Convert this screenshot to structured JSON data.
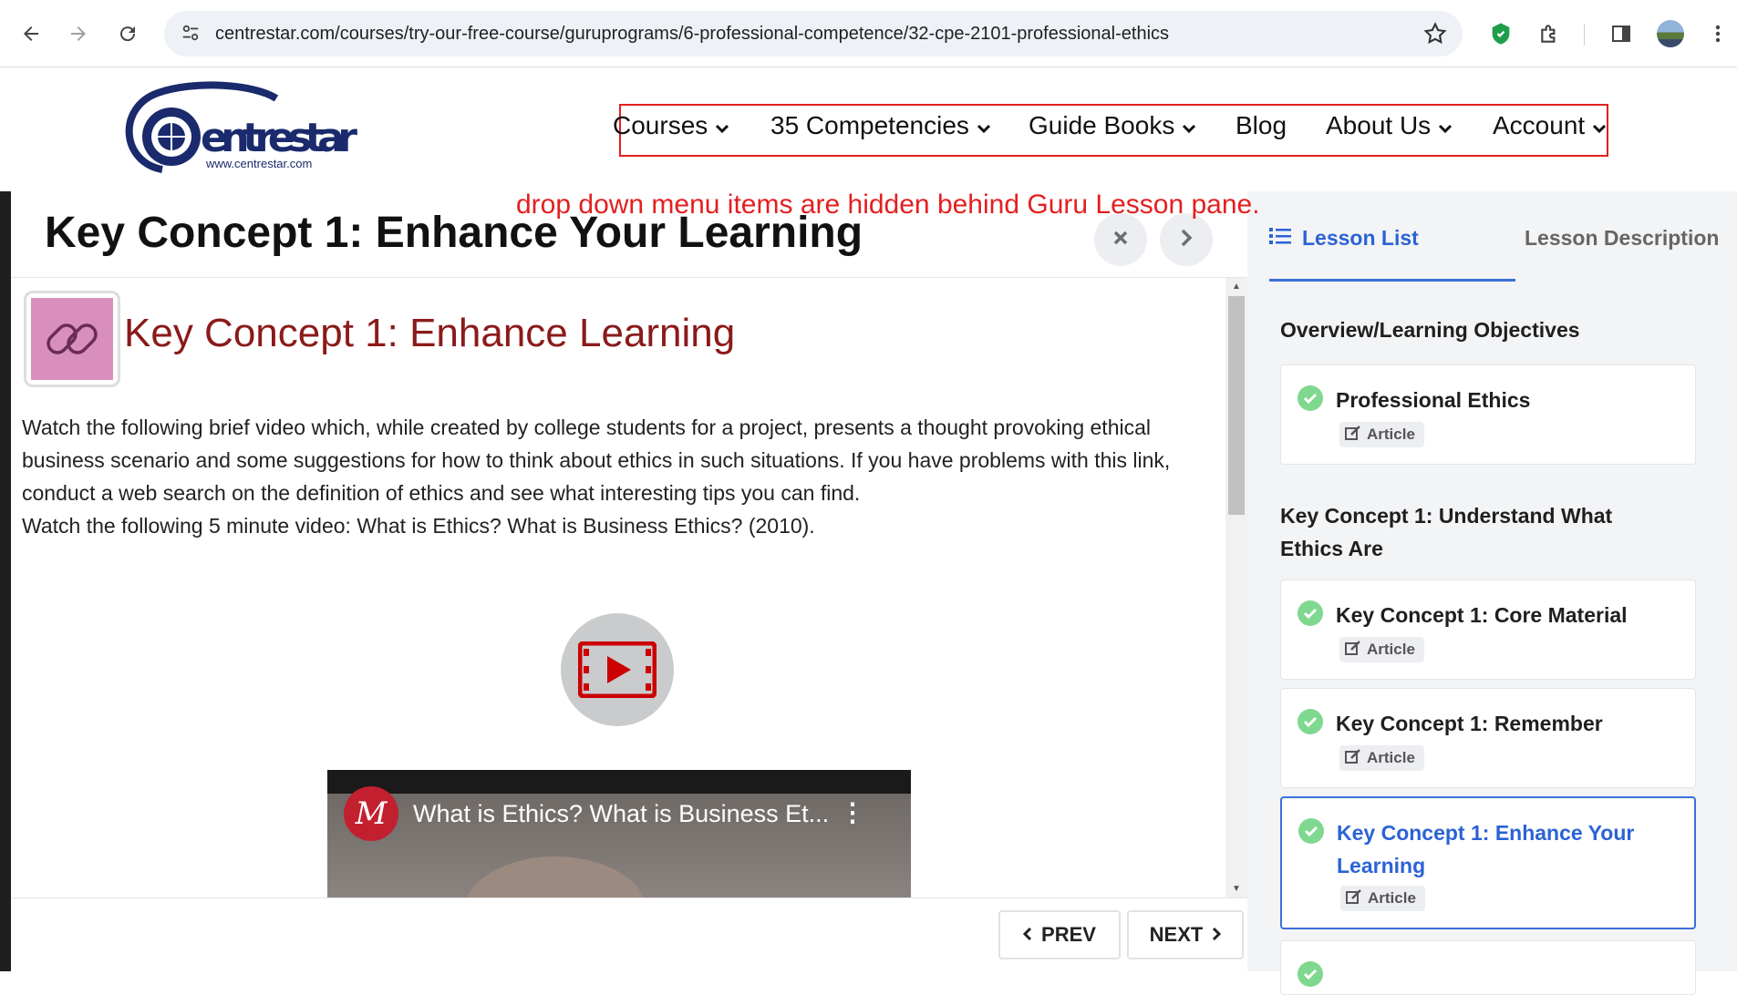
{
  "browser": {
    "url": "centrestar.com/courses/try-our-free-course/guruprograms/6-professional-competence/32-cpe-2101-professional-ethics",
    "icons": [
      "back-icon",
      "forward-icon",
      "reload-icon",
      "site-settings-icon",
      "bookmark-star-icon",
      "extension-shield-icon",
      "extensions-puzzle-icon",
      "side-panel-icon",
      "profile-avatar",
      "more-menu-icon"
    ]
  },
  "site": {
    "logo_text": "Centrestar",
    "logo_sub": "www.centrestar.com",
    "menu": [
      {
        "label": "Courses"
      },
      {
        "label": "35 Competencies"
      },
      {
        "label": "Guide Books"
      },
      {
        "label": "Blog"
      },
      {
        "label": "About Us"
      },
      {
        "label": "Account"
      }
    ]
  },
  "annotation": "drop down menu items are hidden behind Guru Lesson pane.",
  "lesson": {
    "title": "Key Concept 1: Enhance Your Learning",
    "heading": "Key Concept 1: Enhance Learning",
    "paragraph1": "Watch the following brief video which, while created by college students for a project, presents a thought provoking ethical business scenario and some suggestions for how to think about ethics in such situations. If you have problems with this link, conduct a web search on the definition of ethics and see what interesting tips you can find.",
    "paragraph2": "Watch the following 5 minute video: What is Ethics? What is Business Ethics? (2010).",
    "video_title": "What is Ethics? What is Business Et...",
    "video_channel_initial": "M",
    "prev_label": "PREV",
    "next_label": "NEXT"
  },
  "sidebar": {
    "tabs": [
      {
        "label": "Lesson List",
        "active": true
      },
      {
        "label": "Lesson Description",
        "active": false
      }
    ],
    "sections": [
      {
        "title": "Overview/Learning Objectives",
        "items": [
          {
            "title": "Professional Ethics",
            "type": "Article",
            "completed": true,
            "active": false
          }
        ]
      },
      {
        "title": "Key Concept 1: Understand What Ethics Are",
        "items": [
          {
            "title": "Key Concept 1: Core Material",
            "type": "Article",
            "completed": true,
            "active": false
          },
          {
            "title": "Key Concept 1: Remember",
            "type": "Article",
            "completed": true,
            "active": false
          },
          {
            "title": "Key Concept 1: Enhance Your Learning",
            "type": "Article",
            "completed": true,
            "active": true
          }
        ]
      }
    ]
  },
  "colors": {
    "annotation": "#e41f1f",
    "heading": "#8b1a1a",
    "accent": "#3b6fd8",
    "check": "#7fd88f"
  }
}
